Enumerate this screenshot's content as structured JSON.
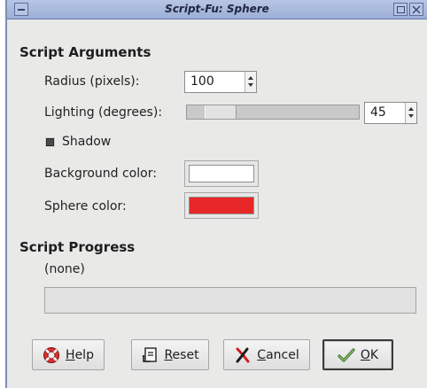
{
  "window": {
    "title": "Script-Fu: Sphere"
  },
  "arguments": {
    "heading": "Script Arguments",
    "radius": {
      "label": "Radius (pixels):",
      "value": "100"
    },
    "lighting": {
      "label": "Lighting (degrees):",
      "value": "45",
      "slider_fraction": 0.125
    },
    "shadow": {
      "label": "Shadow",
      "checked": true
    },
    "background_color": {
      "label": "Background color:",
      "color": "#ffffff"
    },
    "sphere_color": {
      "label": "Sphere color:",
      "color": "#e82828"
    }
  },
  "progress": {
    "heading": "Script Progress",
    "status": "(none)",
    "fraction": 0
  },
  "buttons": {
    "help": {
      "mnemonic": "H",
      "rest": "elp"
    },
    "reset": {
      "mnemonic": "R",
      "rest": "eset"
    },
    "cancel": {
      "mnemonic": "C",
      "rest": "ancel"
    },
    "ok": {
      "mnemonic": "O",
      "rest": "K"
    }
  },
  "icons": {
    "window_menu": "window-menu-icon",
    "maximize": "maximize-icon",
    "close": "close-icon",
    "help": "help-lifebuoy-icon",
    "reset": "reset-icon",
    "cancel": "cancel-x-icon",
    "ok": "ok-check-icon"
  }
}
